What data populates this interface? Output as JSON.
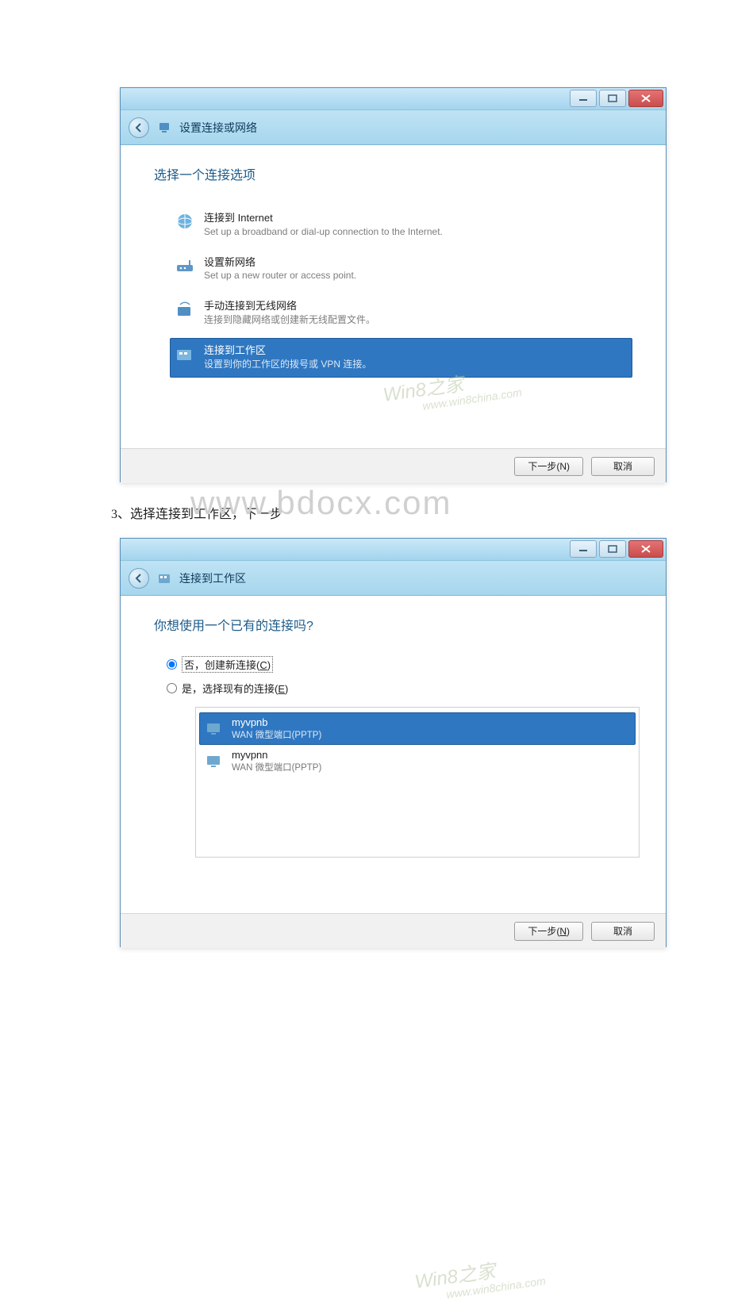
{
  "window_controls": {
    "minimize": "minimize",
    "maximize": "maximize",
    "close": "close"
  },
  "dialog1": {
    "header_title": "设置连接或网络",
    "heading": "选择一个连接选项",
    "options": [
      {
        "title": "连接到 Internet",
        "desc": "Set up a broadband or dial-up connection to the Internet."
      },
      {
        "title": "设置新网络",
        "desc": "Set up a new router or access point."
      },
      {
        "title": "手动连接到无线网络",
        "desc": "连接到隐藏网络或创建新无线配置文件。"
      },
      {
        "title": "连接到工作区",
        "desc": "设置到你的工作区的拨号或 VPN 连接。"
      }
    ],
    "footer": {
      "next": "下一步(N)",
      "cancel": "取消"
    }
  },
  "step_text": "3、选择连接到工作区，下一步",
  "watermark": "www.bdocx.com",
  "inner_watermark_logo": "Win8之家",
  "inner_watermark_url": "www.win8china.com",
  "dialog2": {
    "header_title": "连接到工作区",
    "heading": "你想使用一个已有的连接吗?",
    "radio_no": "否，创建新连接(C)",
    "radio_no_prefix": "否，创建新连接(",
    "radio_no_hotkey": "C",
    "radio_no_suffix": ")",
    "radio_yes_prefix": "是，选择现有的连接(",
    "radio_yes_hotkey": "E",
    "radio_yes_suffix": ")",
    "connections": [
      {
        "name": "myvpnb",
        "sub": "WAN 微型端口(PPTP)"
      },
      {
        "name": "myvpnn",
        "sub": "WAN 微型端口(PPTP)"
      }
    ],
    "footer": {
      "next_prefix": "下一步(",
      "next_hotkey": "N",
      "next_suffix": ")",
      "cancel": "取消"
    }
  }
}
